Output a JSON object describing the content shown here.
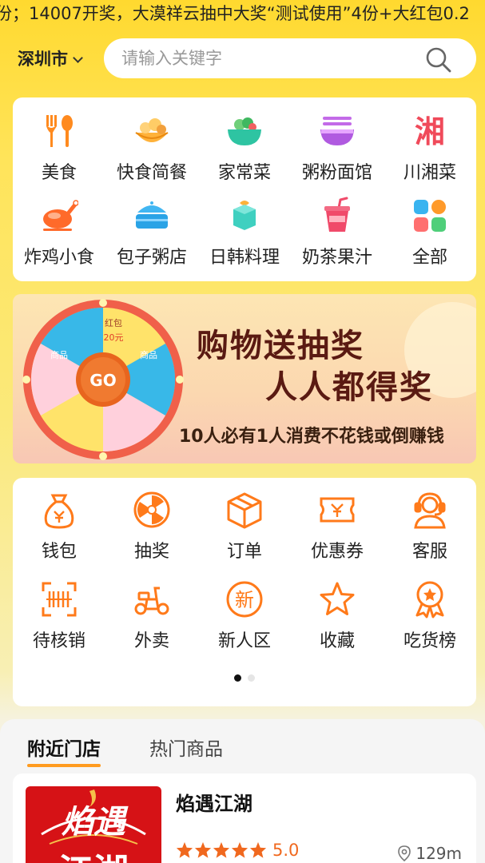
{
  "marquee": {
    "text": "份；14007开奖，大漠祥云抽中大奖“测试使用”4份+大红包0.2"
  },
  "header": {
    "city": "深圳市",
    "search_placeholder": "请输入关键字"
  },
  "categories": [
    {
      "label": "美食",
      "icon": "fork-spoon-icon"
    },
    {
      "label": "快食简餐",
      "icon": "bread-basket-icon"
    },
    {
      "label": "家常菜",
      "icon": "salad-bowl-icon"
    },
    {
      "label": "粥粉面馆",
      "icon": "noodle-bowl-icon"
    },
    {
      "label": "川湘菜",
      "icon": "xiang-character-icon",
      "glyph": "湘"
    },
    {
      "label": "炸鸡小食",
      "icon": "roast-chicken-icon"
    },
    {
      "label": "包子粥店",
      "icon": "steamer-icon"
    },
    {
      "label": "日韩料理",
      "icon": "sushi-icon"
    },
    {
      "label": "奶茶果汁",
      "icon": "milk-tea-icon"
    },
    {
      "label": "全部",
      "icon": "all-grid-icon"
    }
  ],
  "banner": {
    "title1": "购物送抽奖",
    "title2": "人人都得奖",
    "subtitle": "10人必有1人消费不花钱或倒赚钱",
    "wheel": {
      "center": "GO",
      "prize_a": "红包",
      "prize_a_amount": "20元",
      "prize_b": "商品"
    }
  },
  "services": [
    {
      "label": "钱包",
      "icon": "money-bag-icon"
    },
    {
      "label": "抽奖",
      "icon": "prize-wheel-icon"
    },
    {
      "label": "订单",
      "icon": "box-icon"
    },
    {
      "label": "优惠券",
      "icon": "coupon-icon"
    },
    {
      "label": "客服",
      "icon": "headset-icon"
    },
    {
      "label": "待核销",
      "icon": "scan-code-icon"
    },
    {
      "label": "外卖",
      "icon": "scooter-icon"
    },
    {
      "label": "新人区",
      "icon": "new-badge-icon",
      "glyph": "新"
    },
    {
      "label": "收藏",
      "icon": "star-outline-icon"
    },
    {
      "label": "吃货榜",
      "icon": "ranking-medal-icon"
    }
  ],
  "tabs": [
    {
      "label": "附近门店",
      "active": true
    },
    {
      "label": "热门商品",
      "active": false
    }
  ],
  "store": {
    "name": "焰遇江湖",
    "logo_text": "焰遇",
    "rating": "5.0",
    "stars": 5,
    "distance": "129m"
  },
  "colors": {
    "accent": "#ff7a1a",
    "brand_yellow": "#ffd92f",
    "star": "#f0681e"
  }
}
